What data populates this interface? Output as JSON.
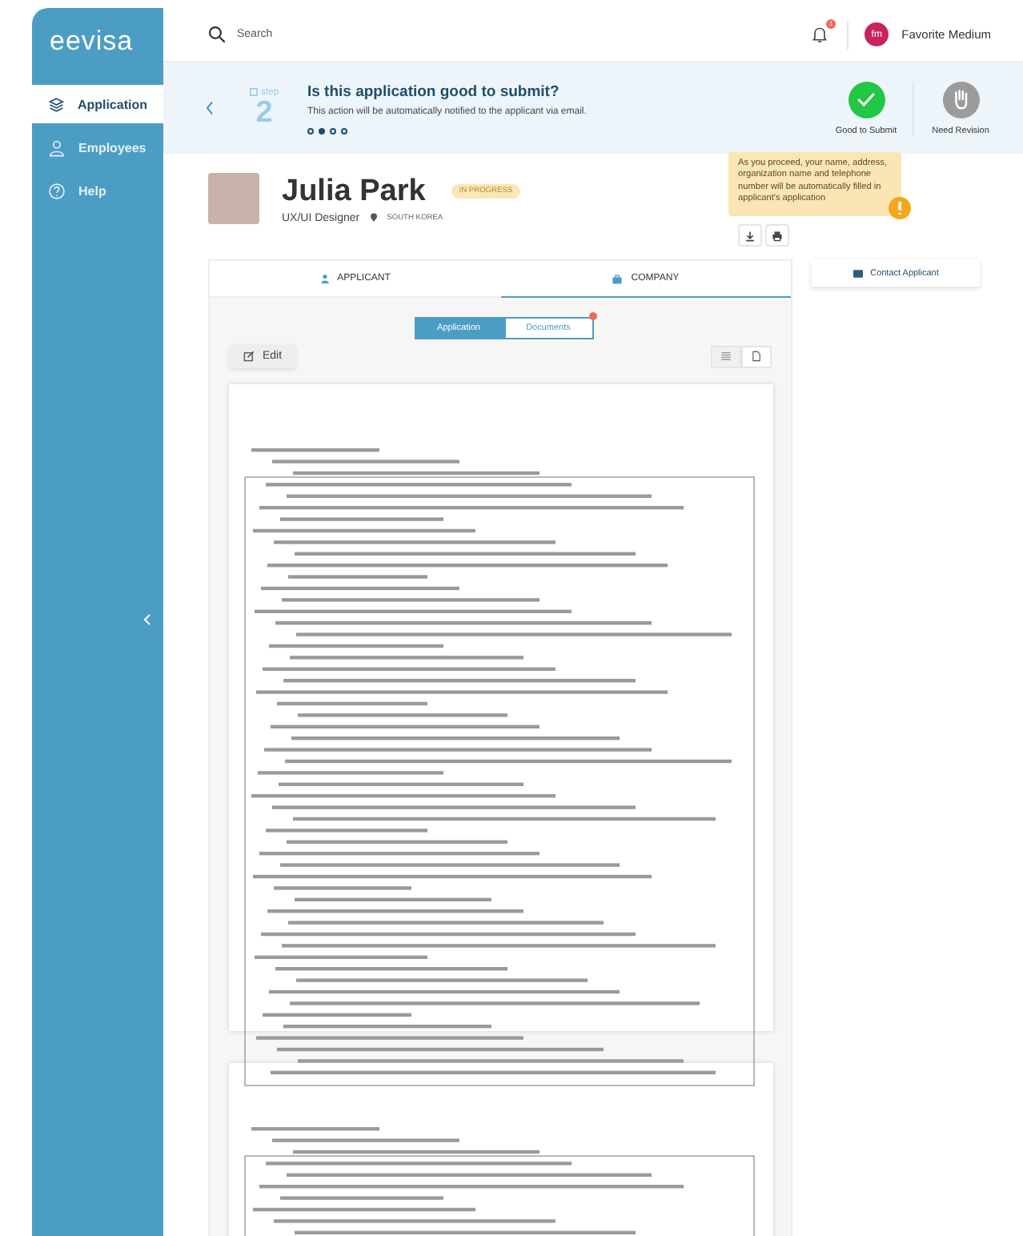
{
  "sidebar": {
    "logo": "eevisa",
    "items": [
      {
        "label": "Application",
        "kind": "layers",
        "selected": true
      },
      {
        "label": "Employees",
        "kind": "person",
        "selected": false
      },
      {
        "label": "Help",
        "kind": "help",
        "selected": false
      }
    ]
  },
  "topbar": {
    "search": {
      "placeholder": "Search"
    },
    "notification_count": "1",
    "user": {
      "initials": "fm",
      "name": "Favorite Medium"
    }
  },
  "step": {
    "label": "step",
    "number": "2",
    "title": "Is this application good to submit?",
    "subtitle": "This action will be automatically notified to the applicant via email.",
    "dots": [
      {
        "selected": false
      },
      {
        "selected": true
      },
      {
        "selected": false
      },
      {
        "selected": false
      }
    ],
    "actions": [
      {
        "label": "Good to Submit",
        "kind": "approve",
        "selected": true
      },
      {
        "label": "Need Revision",
        "kind": "revise",
        "selected": false
      }
    ]
  },
  "tooltip": "As you proceed, your name, address, organization name and telephone number will be automatically filled in applicant's application",
  "profile": {
    "name": "Julia Park",
    "status": "IN PROGRESS",
    "role": "UX/UI Designer",
    "location": "SOUTH KOREA"
  },
  "tabs": [
    {
      "label": "APPLICANT",
      "kind": "person",
      "selected": false
    },
    {
      "label": "COMPANY",
      "kind": "briefcase",
      "selected": true
    }
  ],
  "contact_button": "Contact Applicant",
  "segments": [
    {
      "label": "Application",
      "selected": true,
      "has_notification": false
    },
    {
      "label": "Documents",
      "selected": false,
      "has_notification": true
    }
  ],
  "edit_button": "Edit",
  "view_toggles": [
    {
      "kind": "grid",
      "selected": false
    },
    {
      "kind": "page",
      "selected": true
    }
  ],
  "document_pages": [
    {
      "kind": "scan"
    },
    {
      "kind": "scan"
    }
  ]
}
